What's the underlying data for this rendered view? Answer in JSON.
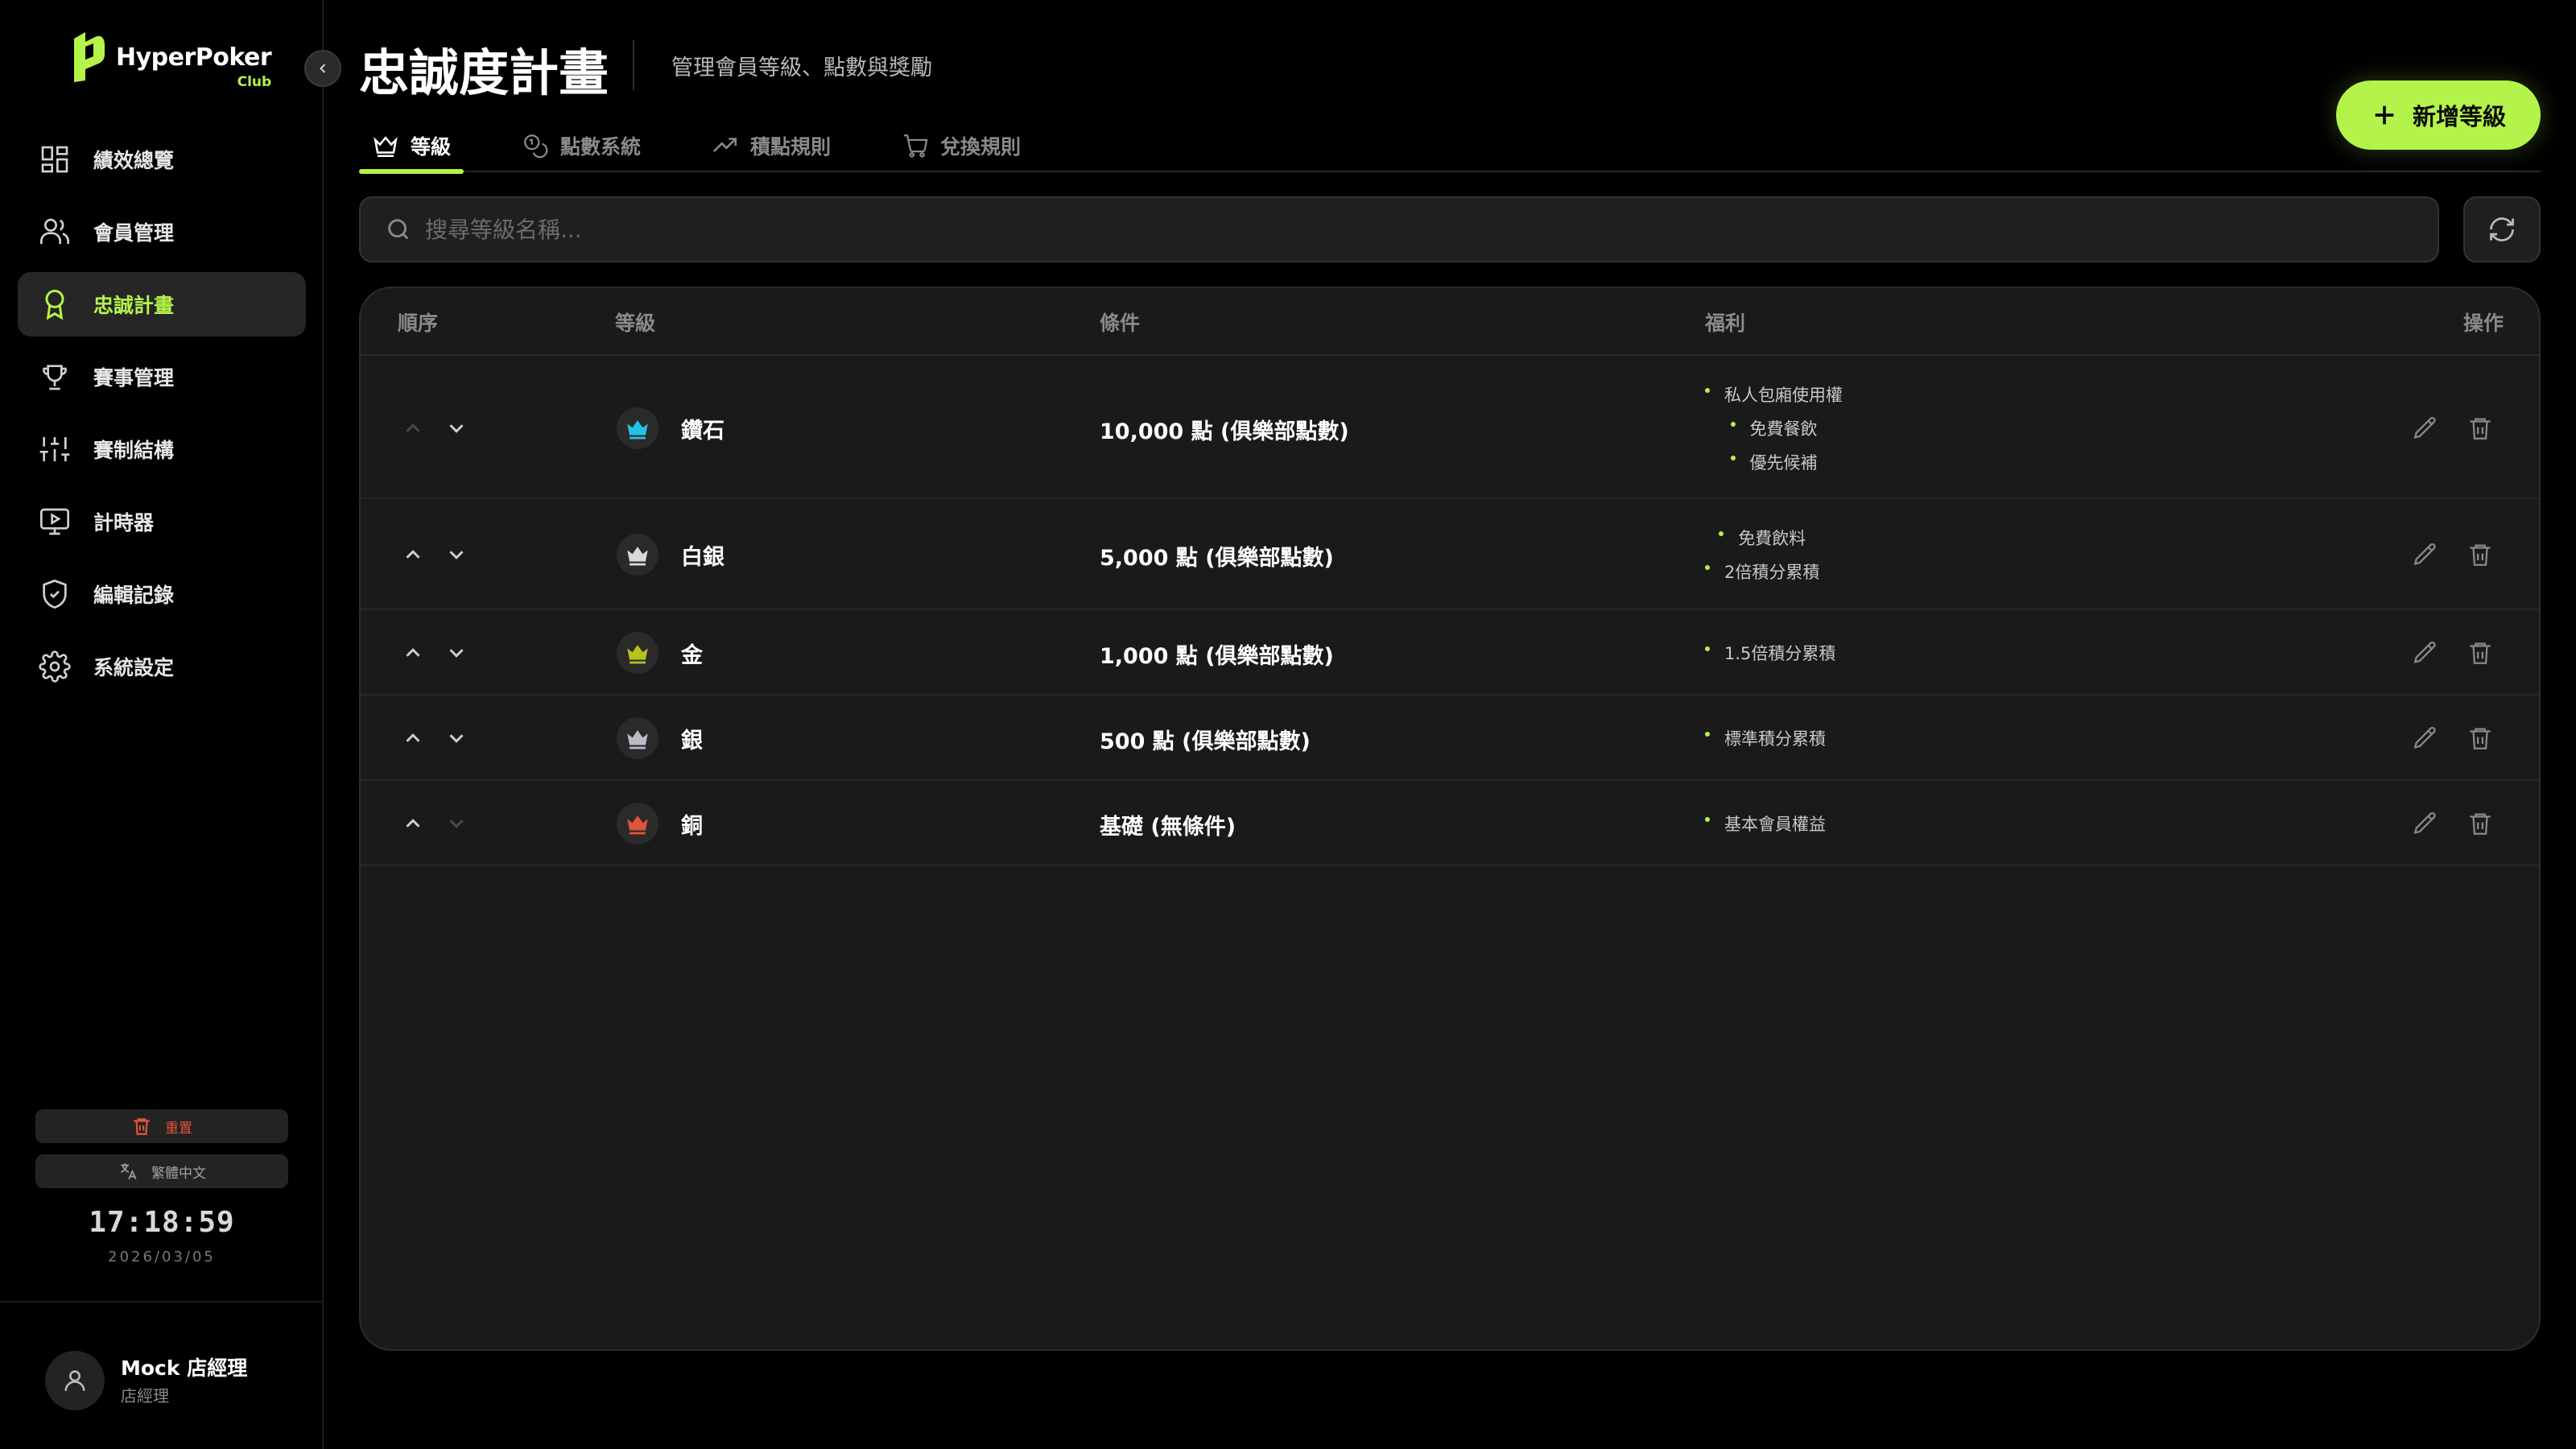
{
  "brand": {
    "name": "HyperPoker",
    "sub": "Club",
    "accent": "#b4f34a"
  },
  "sidebar": {
    "items": [
      {
        "label": "績效總覽",
        "icon": "dashboard-icon",
        "active": false
      },
      {
        "label": "會員管理",
        "icon": "users-icon",
        "active": false
      },
      {
        "label": "忠誠計畫",
        "icon": "award-icon",
        "active": true
      },
      {
        "label": "賽事管理",
        "icon": "trophy-icon",
        "active": false
      },
      {
        "label": "賽制結構",
        "icon": "sliders-icon",
        "active": false
      },
      {
        "label": "計時器",
        "icon": "monitor-icon",
        "active": false
      },
      {
        "label": "編輯記錄",
        "icon": "shield-icon",
        "active": false
      },
      {
        "label": "系統設定",
        "icon": "gear-icon",
        "active": false
      }
    ],
    "reset_label": "重置",
    "language_label": "繁體中文",
    "clock": "17:18:59",
    "date": "2026/03/05"
  },
  "user": {
    "name": "Mock 店經理",
    "role": "店經理"
  },
  "header": {
    "title": "忠誠度計畫",
    "subtitle": "管理會員等級、點數與獎勵",
    "add_button": "新增等級"
  },
  "tabs": [
    {
      "label": "等級",
      "icon": "crown-icon",
      "active": true
    },
    {
      "label": "點數系統",
      "icon": "coins-icon",
      "active": false
    },
    {
      "label": "積點規則",
      "icon": "trending-up-icon",
      "active": false
    },
    {
      "label": "兌換規則",
      "icon": "cart-icon",
      "active": false
    }
  ],
  "search": {
    "placeholder": "搜尋等級名稱..."
  },
  "table": {
    "columns": {
      "order": "順序",
      "tier": "等級",
      "condition": "條件",
      "benefits": "福利",
      "actions": "操作"
    },
    "rows": [
      {
        "name": "鑽石",
        "crown_color": "#22c3e6",
        "condition": "10,000 點 (俱樂部點數)",
        "benefits": [
          "私人包廂使用權",
          "免費餐飲",
          "優先候補"
        ],
        "up_enabled": false,
        "down_enabled": true
      },
      {
        "name": "白銀",
        "crown_color": "#d9d9d9",
        "condition": "5,000 點 (俱樂部點數)",
        "benefits": [
          "免費飲料",
          "2倍積分累積"
        ],
        "up_enabled": true,
        "down_enabled": true
      },
      {
        "name": "金",
        "crown_color": "#b8c21d",
        "condition": "1,000 點 (俱樂部點數)",
        "benefits": [
          "1.5倍積分累積"
        ],
        "up_enabled": true,
        "down_enabled": true
      },
      {
        "name": "銀",
        "crown_color": "#b9bcc4",
        "condition": "500 點 (俱樂部點數)",
        "benefits": [
          "標準積分累積"
        ],
        "up_enabled": true,
        "down_enabled": true
      },
      {
        "name": "銅",
        "crown_color": "#e0543a",
        "condition": "基礎 (無條件)",
        "benefits": [
          "基本會員權益"
        ],
        "up_enabled": true,
        "down_enabled": false
      }
    ]
  }
}
